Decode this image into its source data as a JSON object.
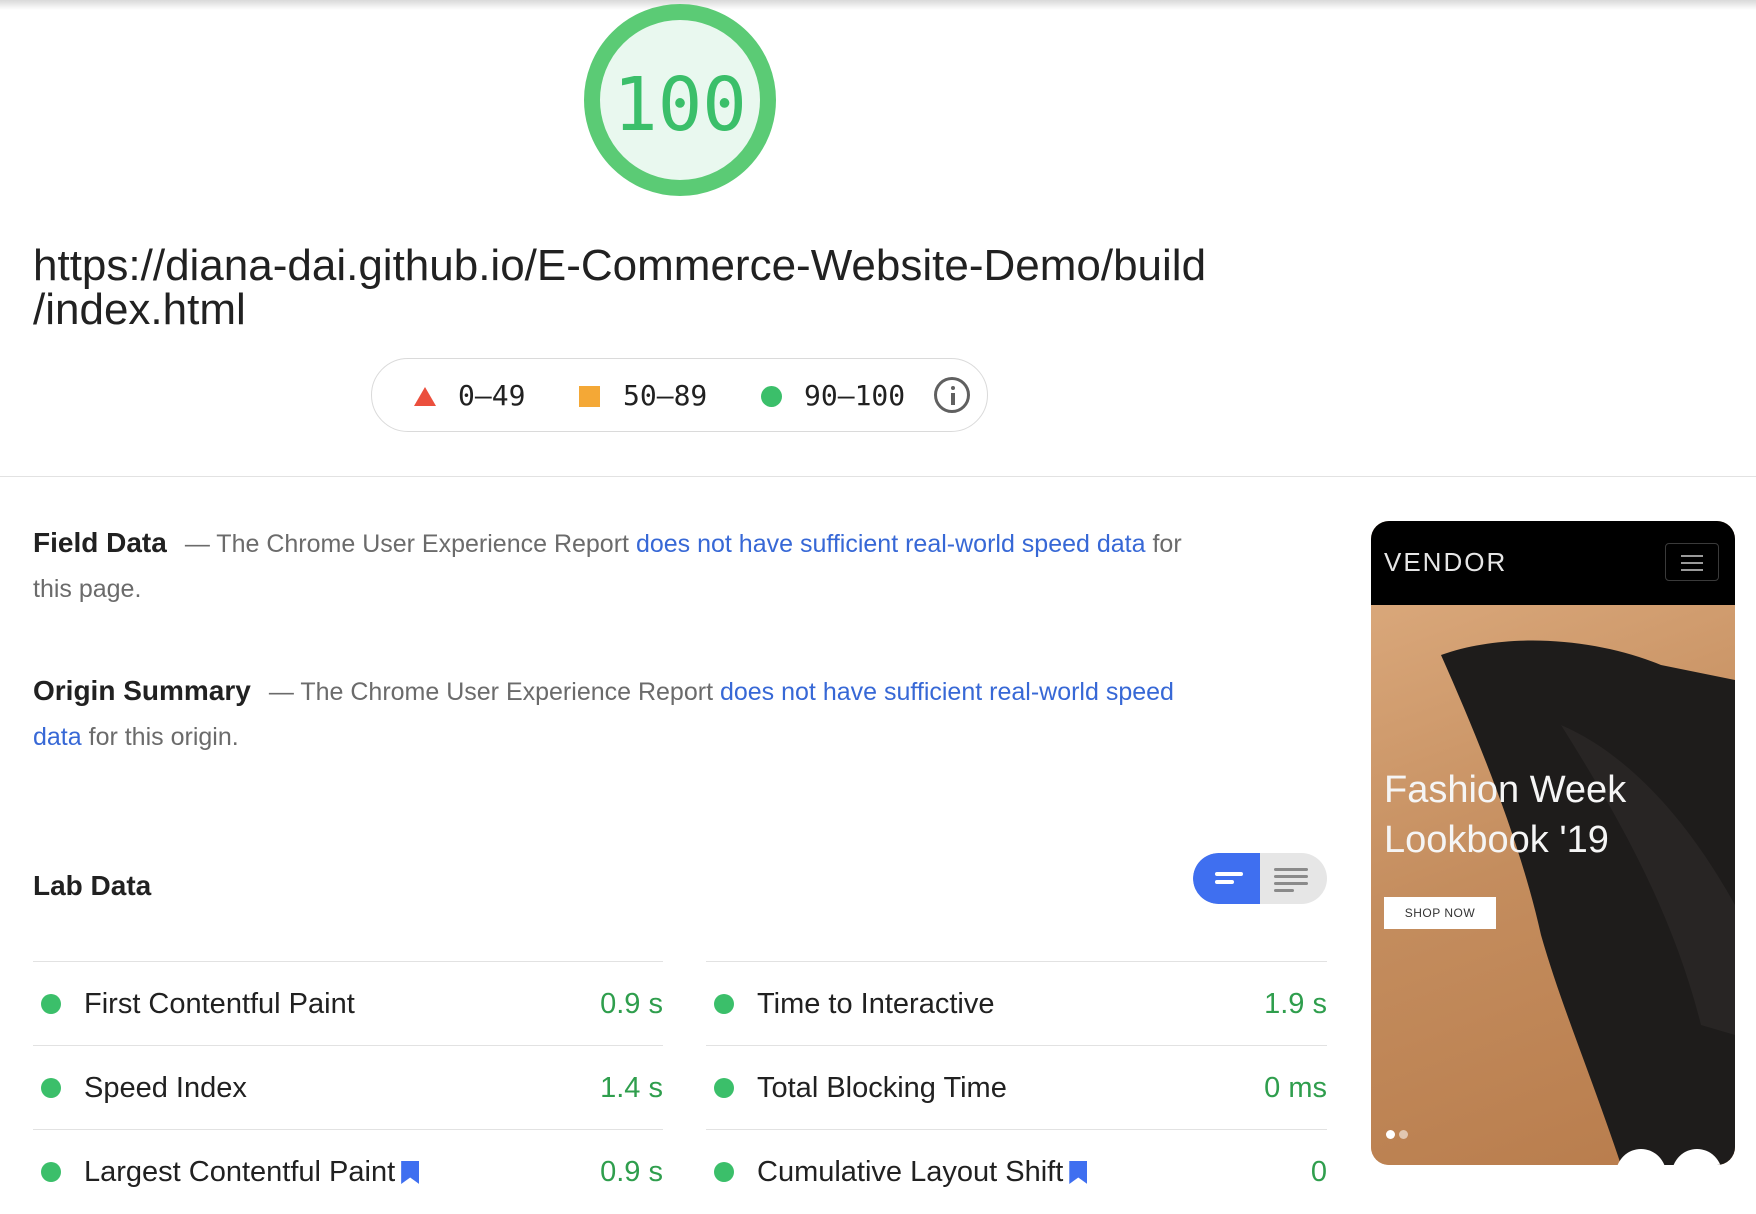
{
  "gauge": {
    "score": "100",
    "fraction": 1.0,
    "color": "#3bbf6a"
  },
  "report": {
    "url": "https://diana-dai.github.io/E-Commerce-Website-Demo/build/index.html",
    "url_line1": "https://diana-dai.github.io/E-Commerce-Website-Demo/build",
    "url_line2": "/index.html"
  },
  "legend": {
    "poor": "0–49",
    "average": "50–89",
    "good": "90–100",
    "info_icon": "info-icon"
  },
  "field_data": {
    "title": "Field Data",
    "prefix": "— The Chrome User Experience Report ",
    "link": "does not have sufficient real-world speed data",
    "suffix": " for this page."
  },
  "origin_summary": {
    "title": "Origin Summary",
    "prefix": "— The Chrome User Experience Report ",
    "link": "does not have sufficient real-world speed data",
    "suffix": " for this origin."
  },
  "lab_data": {
    "title": "Lab Data",
    "metrics_left": [
      {
        "name": "First Contentful Paint",
        "value": "0.9 s",
        "bookmark": false
      },
      {
        "name": "Speed Index",
        "value": "1.4 s",
        "bookmark": false
      },
      {
        "name": "Largest Contentful Paint",
        "value": "0.9 s",
        "bookmark": true
      }
    ],
    "metrics_right": [
      {
        "name": "Time to Interactive",
        "value": "1.9 s",
        "bookmark": false
      },
      {
        "name": "Total Blocking Time",
        "value": "0 ms",
        "bookmark": false
      },
      {
        "name": "Cumulative Layout Shift",
        "value": "0",
        "bookmark": true
      }
    ]
  },
  "screenshot": {
    "brand": "VENDOR",
    "hero_line1": "Fashion Week",
    "hero_line2": "Lookbook '19",
    "cta": "SHOP NOW",
    "prev_arrow": "←",
    "next_arrow": "→"
  },
  "colors": {
    "good": "#3bbf6a",
    "average": "#f4a836",
    "poor": "#eb4f3d",
    "link": "#3768d6",
    "accent": "#3f6ff0"
  }
}
